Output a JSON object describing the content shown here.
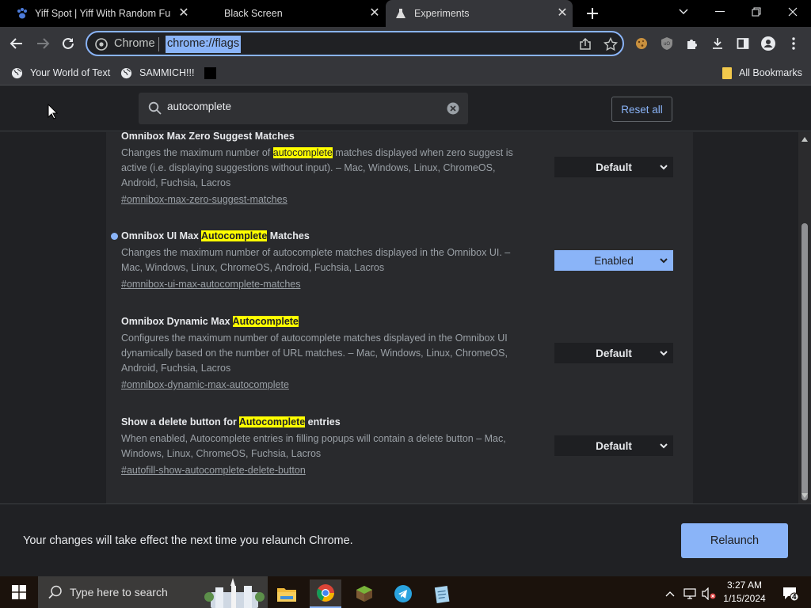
{
  "tabs": [
    {
      "title": "Yiff Spot | Yiff With Random Fun",
      "active": false
    },
    {
      "title": "Black Screen",
      "active": false
    },
    {
      "title": "Experiments",
      "active": true
    }
  ],
  "omnibox": {
    "scheme_label": "Chrome",
    "url": "chrome://flags"
  },
  "bookmarks": {
    "items": [
      {
        "label": "Your World of Text"
      },
      {
        "label": "SAMMICH!!!"
      }
    ],
    "all_label": "All Bookmarks"
  },
  "flags_page": {
    "search_value": "autocomplete",
    "reset_label": "Reset all",
    "flags": [
      {
        "title": "Omnibox Max Zero Suggest Matches",
        "desc_pre": "Changes the maximum number of ",
        "desc_hl": "autocomplete",
        "desc_post": " matches displayed when zero suggest is active (i.e. displaying suggestions without input). – Mac, Windows, Linux, ChromeOS, Android, Fuchsia, Lacros",
        "link": "#omnibox-max-zero-suggest-matches",
        "value": "Default"
      },
      {
        "title_pre": "Omnibox UI Max ",
        "title_hl": "Autocomplete",
        "title_post": " Matches",
        "desc": "Changes the maximum number of autocomplete matches displayed in the Omnibox UI. – Mac, Windows, Linux, ChromeOS, Android, Fuchsia, Lacros",
        "link": "#omnibox-ui-max-autocomplete-matches",
        "value": "Enabled"
      },
      {
        "title_pre": "Omnibox Dynamic Max ",
        "title_hl": "Autocomplete",
        "title_post": "",
        "desc": "Configures the maximum number of autocomplete matches displayed in the Omnibox UI dynamically based on the number of URL matches. – Mac, Windows, Linux, ChromeOS, Android, Fuchsia, Lacros",
        "link": "#omnibox-dynamic-max-autocomplete",
        "value": "Default"
      },
      {
        "title_pre": "Show a delete button for ",
        "title_hl": "Autocomplete",
        "title_post": " entries",
        "desc": "When enabled, Autocomplete entries in filling popups will contain a delete button – Mac, Windows, Linux, ChromeOS, Fuchsia, Lacros",
        "link": "#autofill-show-autocomplete-delete-button",
        "value": "Default"
      }
    ]
  },
  "relaunch": {
    "message": "Your changes will take effect the next time you relaunch Chrome.",
    "button": "Relaunch"
  },
  "taskbar": {
    "search_placeholder": "Type here to search",
    "time": "3:27 AM",
    "date": "1/15/2024",
    "notification_count": "4"
  },
  "colors": {
    "accent": "#8ab4f8",
    "highlight": "#ffff00",
    "page_bg": "#202124",
    "card_bg": "#292a2d"
  }
}
